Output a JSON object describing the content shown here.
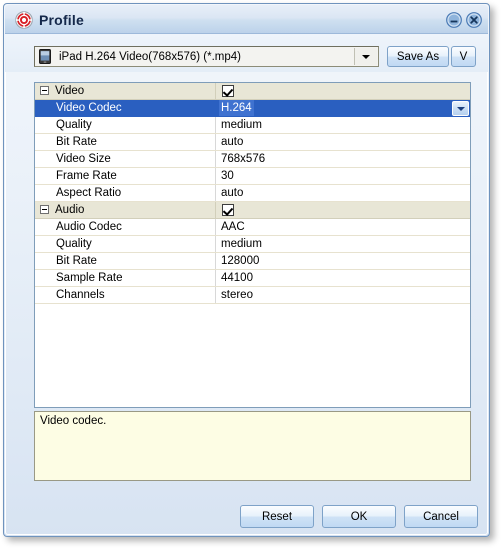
{
  "window": {
    "title": "Profile",
    "icon": "gear-target-icon",
    "controls": [
      {
        "name": "minimize",
        "glyph": "minimize-icon"
      },
      {
        "name": "close",
        "glyph": "close-icon"
      }
    ],
    "accent_color": "#2a5fc0",
    "titlebar_color": "#cedff0",
    "icon_color": "#d81f26"
  },
  "toolbar": {
    "profile_combo": {
      "value": "iPad H.264 Video(768x576) (*.mp4)",
      "icon": "device-icon",
      "arrow": "chevron-down-icon"
    },
    "save_as_label": "Save As",
    "v_label": "V"
  },
  "table": {
    "groups": [
      {
        "label": "Video",
        "checked": true,
        "rows": [
          {
            "name": "Video Codec",
            "value": "H.264",
            "selected": true,
            "has_dropdown": true
          },
          {
            "name": "Quality",
            "value": "medium",
            "selected": false,
            "has_dropdown": false
          },
          {
            "name": "Bit Rate",
            "value": "auto",
            "selected": false,
            "has_dropdown": false
          },
          {
            "name": "Video Size",
            "value": "768x576",
            "selected": false,
            "has_dropdown": false
          },
          {
            "name": "Frame Rate",
            "value": "30",
            "selected": false,
            "has_dropdown": false
          },
          {
            "name": "Aspect Ratio",
            "value": "auto",
            "selected": false,
            "has_dropdown": false
          }
        ]
      },
      {
        "label": "Audio",
        "checked": true,
        "rows": [
          {
            "name": "Audio Codec",
            "value": "AAC",
            "selected": false,
            "has_dropdown": false
          },
          {
            "name": "Quality",
            "value": "medium",
            "selected": false,
            "has_dropdown": false
          },
          {
            "name": "Bit Rate",
            "value": "128000",
            "selected": false,
            "has_dropdown": false
          },
          {
            "name": "Sample Rate",
            "value": "44100",
            "selected": false,
            "has_dropdown": false
          },
          {
            "name": "Channels",
            "value": "stereo",
            "selected": false,
            "has_dropdown": false
          }
        ]
      }
    ]
  },
  "hint": {
    "text": "Video codec."
  },
  "footer": {
    "reset_label": "Reset",
    "ok_label": "OK",
    "cancel_label": "Cancel"
  }
}
